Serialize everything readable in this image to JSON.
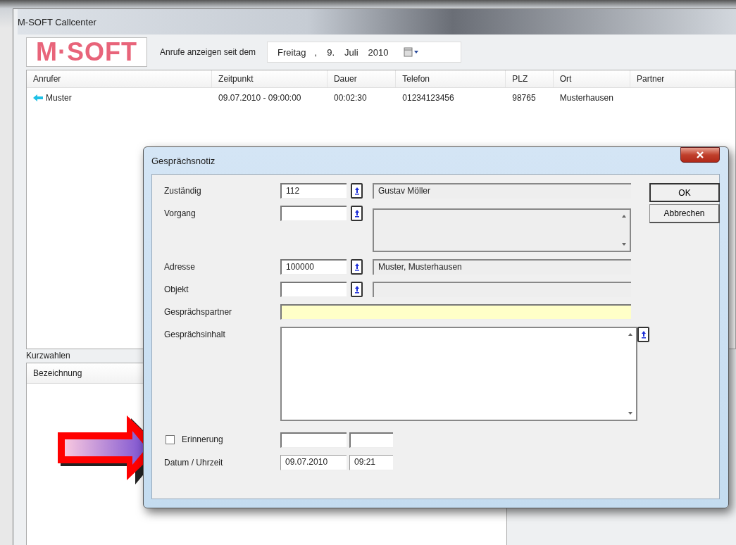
{
  "window": {
    "title": "M-SOFT Callcenter"
  },
  "toolbar": {
    "logo": "M·SOFT",
    "filter_label": "Anrufe anzeigen seit dem",
    "date": {
      "weekday": "Freitag",
      "separator": ",",
      "day": "9.",
      "month": "Juli",
      "year": "2010"
    }
  },
  "calls_table": {
    "columns": [
      "Anrufer",
      "Zeitpunkt",
      "Dauer",
      "Telefon",
      "PLZ",
      "Ort",
      "Partner"
    ],
    "rows": [
      {
        "cells": [
          "Muster",
          "09.07.2010 - 09:00:00",
          "00:02:30",
          "01234123456",
          "98765",
          "Musterhausen",
          null
        ]
      }
    ]
  },
  "speed_dial": {
    "title": "Kurzwahlen",
    "columns": [
      "Bezeichnung"
    ]
  },
  "dialog": {
    "title": "Gesprächsnotiz",
    "fields": [
      {
        "kind": "lookup",
        "label": "Zuständig",
        "value": "112",
        "description": "Gustav Möller"
      },
      {
        "kind": "lookup_memo",
        "label": "Vorgang"
      },
      {
        "kind": "lookup",
        "label": "Adresse",
        "value": "100000",
        "description": "Muster, Musterhausen"
      },
      {
        "kind": "lookup",
        "label": "Objekt"
      },
      {
        "kind": "highlight",
        "label": "Gesprächspartner"
      },
      {
        "kind": "memo",
        "label": "Gesprächsinhalt"
      }
    ],
    "reminder": {
      "label": "Erinnerung",
      "checked": false
    },
    "datetime": {
      "label": "Datum / Uhrzeit",
      "date": "09.07.2010",
      "time": "09:21"
    },
    "buttons": [
      "OK",
      "Abbrechen"
    ]
  }
}
